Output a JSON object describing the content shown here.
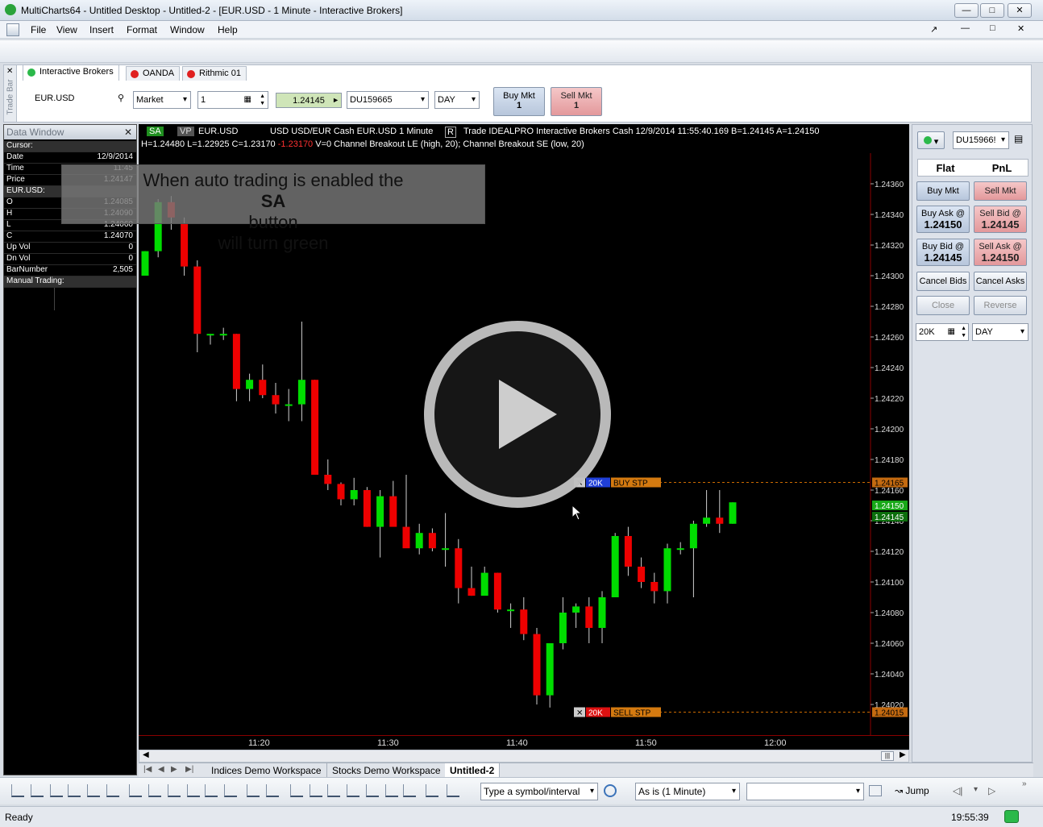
{
  "app": {
    "title": "MultiCharts64 - Untitled Desktop - Untitled-2 - [EUR.USD - 1 Minute - Interactive Brokers]"
  },
  "menu": [
    "File",
    "View",
    "Insert",
    "Format",
    "Window",
    "Help"
  ],
  "tradebar": {
    "side_label": "Trade Bar",
    "tabs": [
      "Interactive Brokers",
      "OANDA",
      "Rithmic 01"
    ],
    "symbol": "EUR.USD",
    "order_type": "Market",
    "quantity": "1",
    "price": "1.24145",
    "account": "DU159665",
    "tif": "DAY",
    "buy_mkt": "Buy Mkt",
    "buy_qty": "1",
    "sell_mkt": "Sell Mkt",
    "sell_qty": "1"
  },
  "data_window": {
    "title": "Data Window",
    "rows": [
      {
        "k": "Cursor:",
        "v": ""
      },
      {
        "k": "Date",
        "v": "12/9/2014"
      },
      {
        "k": "Time",
        "v": "11:45"
      },
      {
        "k": "Price",
        "v": "1.24147"
      },
      {
        "k": "EUR.USD:",
        "v": ""
      },
      {
        "k": "O",
        "v": "1.24085"
      },
      {
        "k": "H",
        "v": "1.24090"
      },
      {
        "k": "L",
        "v": "1.24060"
      },
      {
        "k": "C",
        "v": "1.24070"
      },
      {
        "k": "Up Vol",
        "v": "0"
      },
      {
        "k": "Dn Vol",
        "v": "0"
      },
      {
        "k": "BarNumber",
        "v": "2,505"
      },
      {
        "k": "Manual Trading:",
        "v": ""
      }
    ]
  },
  "overlay": {
    "line1_pre": "When auto trading is enabled the",
    "line1_bold": "SA",
    "line1_post": "button",
    "line2": "will turn green"
  },
  "chart_header": {
    "sa": "SA",
    "vp": "VP",
    "symbol": "EUR.USD",
    "desc": "USD USD/EUR Cash EUR.USD  1 Minute",
    "r": "R",
    "trade": "Trade  IDEALPRO  Interactive Brokers  Cash  12/9/2014  11:55:40.169  B=1.24145  A=1.24150",
    "line2_pre": "H=1.24480  L=1.22925  C=1.23170",
    "line2_change": "-1.23170",
    "line2_post": "V=0  Channel Breakout LE (high, 20); Channel Breakout SE (low, 20)"
  },
  "orders": {
    "buy": {
      "qty": "20K",
      "label": "BUY STP",
      "price": "1.24165"
    },
    "sell": {
      "qty": "20K",
      "label": "SELL STP",
      "price": "1.24015"
    },
    "bid_tag": "1.24150",
    "ask_tag": "1.24145"
  },
  "chart_data": {
    "type": "candlestick",
    "ylim": [
      1.24,
      1.2438
    ],
    "yticks": [
      "1.24360",
      "1.24340",
      "1.24320",
      "1.24300",
      "1.24280",
      "1.24260",
      "1.24240",
      "1.24220",
      "1.24200",
      "1.24180",
      "1.24160",
      "1.24140",
      "1.24120",
      "1.24100",
      "1.24080",
      "1.24060",
      "1.24040",
      "1.24020"
    ],
    "xticks": [
      "11:20",
      "11:30",
      "11:40",
      "11:50",
      "12:00"
    ],
    "colors": {
      "up": "#00dd00",
      "down": "#ee0000",
      "cursor": "#cc0000"
    },
    "candles": [
      [
        1.243,
        1.24316,
        1.243,
        1.24316
      ],
      [
        1.24316,
        1.2435,
        1.24312,
        1.24348
      ],
      [
        1.24348,
        1.24352,
        1.2433,
        1.24338
      ],
      [
        1.24334,
        1.24338,
        1.243,
        1.24306
      ],
      [
        1.24306,
        1.2431,
        1.2425,
        1.24262
      ],
      [
        1.24262,
        1.24262,
        1.24255,
        1.24262
      ],
      [
        1.24262,
        1.24266,
        1.24258,
        1.24262
      ],
      [
        1.24262,
        1.24262,
        1.24218,
        1.24226
      ],
      [
        1.24226,
        1.24236,
        1.24218,
        1.24232
      ],
      [
        1.24232,
        1.24242,
        1.2422,
        1.24222
      ],
      [
        1.24222,
        1.2423,
        1.2421,
        1.24216
      ],
      [
        1.24216,
        1.24226,
        1.24205,
        1.24216
      ],
      [
        1.24216,
        1.2427,
        1.24205,
        1.24232
      ],
      [
        1.24232,
        1.24232,
        1.2417,
        1.2417
      ],
      [
        1.2417,
        1.2418,
        1.2416,
        1.24164
      ],
      [
        1.24164,
        1.24165,
        1.2415,
        1.24154
      ],
      [
        1.24154,
        1.24168,
        1.2415,
        1.2416
      ],
      [
        1.2416,
        1.24162,
        1.24136,
        1.24136
      ],
      [
        1.24136,
        1.2416,
        1.24116,
        1.24156
      ],
      [
        1.24156,
        1.24166,
        1.2414,
        1.24136
      ],
      [
        1.24136,
        1.2417,
        1.24128,
        1.24122
      ],
      [
        1.24122,
        1.24138,
        1.24118,
        1.24132
      ],
      [
        1.24132,
        1.24135,
        1.2412,
        1.24122
      ],
      [
        1.24122,
        1.24145,
        1.2411,
        1.24122
      ],
      [
        1.24122,
        1.24128,
        1.24086,
        1.24096
      ],
      [
        1.24096,
        1.2411,
        1.24091,
        1.24091
      ],
      [
        1.24091,
        1.2411,
        1.24092,
        1.24106
      ],
      [
        1.24106,
        1.24106,
        1.2408,
        1.24082
      ],
      [
        1.24082,
        1.24086,
        1.2407,
        1.24082
      ],
      [
        1.24082,
        1.2409,
        1.24062,
        1.24066
      ],
      [
        1.24066,
        1.2407,
        1.2402,
        1.24026
      ],
      [
        1.24026,
        1.2406,
        1.24018,
        1.2406
      ],
      [
        1.2406,
        1.2409,
        1.24056,
        1.2408
      ],
      [
        1.2408,
        1.24086,
        1.2407,
        1.24084
      ],
      [
        1.24084,
        1.2409,
        1.2406,
        1.2407
      ],
      [
        1.2407,
        1.24094,
        1.2406,
        1.2409
      ],
      [
        1.2409,
        1.24132,
        1.2409,
        1.2413
      ],
      [
        1.2413,
        1.24136,
        1.24104,
        1.2411
      ],
      [
        1.2411,
        1.24116,
        1.24096,
        1.241
      ],
      [
        1.241,
        1.24106,
        1.24086,
        1.24094
      ],
      [
        1.24094,
        1.24125,
        1.24086,
        1.24122
      ],
      [
        1.24122,
        1.24126,
        1.24118,
        1.24122
      ],
      [
        1.24122,
        1.2414,
        1.2409,
        1.24138
      ],
      [
        1.24138,
        1.2416,
        1.24136,
        1.24142
      ],
      [
        1.24142,
        1.2416,
        1.24132,
        1.24138
      ],
      [
        1.24138,
        1.24152,
        1.24138,
        1.24152
      ]
    ]
  },
  "dom": {
    "account": "DU15966!",
    "flat": "Flat",
    "pnl": "PnL",
    "buy_mkt": "Buy Mkt",
    "sell_mkt": "Sell Mkt",
    "buy_ask_label": "Buy Ask @",
    "buy_ask": "1.24150",
    "sell_bid_label": "Sell Bid @",
    "sell_bid": "1.24145",
    "buy_bid_label": "Buy Bid @",
    "buy_bid": "1.24145",
    "sell_ask_label": "Sell Ask @",
    "sell_ask": "1.24150",
    "cancel_bids": "Cancel Bids",
    "cancel_asks": "Cancel Asks",
    "close": "Close",
    "reverse": "Reverse",
    "qty": "20K",
    "tif": "DAY"
  },
  "workspaces": [
    "Indices Demo Workspace",
    "Stocks Demo Workspace",
    "Untitled-2"
  ],
  "drawbar": {
    "symbol_placeholder": "Type a symbol/interval",
    "resolution": "As is (1 Minute)",
    "jump": "Jump"
  },
  "status": {
    "text": "Ready",
    "time": "19:55:39"
  }
}
